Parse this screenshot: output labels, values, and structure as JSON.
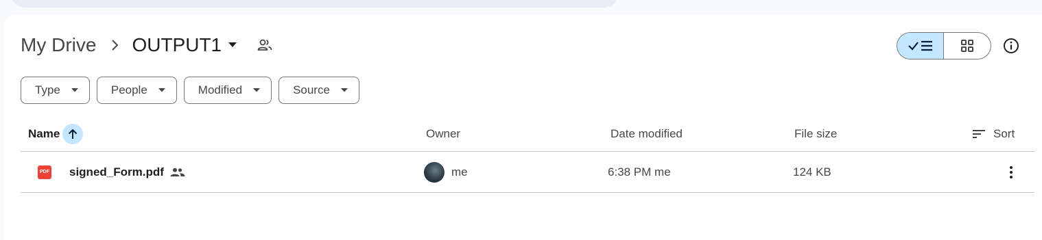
{
  "breadcrumb": {
    "root": "My Drive",
    "current": "OUTPUT1"
  },
  "filters": [
    {
      "label": "Type"
    },
    {
      "label": "People"
    },
    {
      "label": "Modified"
    },
    {
      "label": "Source"
    }
  ],
  "table": {
    "columns": {
      "name": "Name",
      "owner": "Owner",
      "date_modified": "Date modified",
      "file_size": "File size",
      "sort": "Sort"
    },
    "rows": [
      {
        "name": "signed_Form.pdf",
        "file_type_badge": "PDF",
        "owner": "me",
        "date_modified": "6:38 PM me",
        "file_size": "124 KB"
      }
    ]
  },
  "icons": {
    "file": "pdf-icon",
    "shared": "people-icon",
    "sort_direction": "arrow-up-icon",
    "sort": "sort-lines-icon",
    "more": "more-vertical-icon",
    "info": "info-icon",
    "list_view": "check-list-icon",
    "grid_view": "grid-icon"
  },
  "colors": {
    "accent": "#c2e7ff",
    "pdf_badge": "#ea4335",
    "border": "#747775",
    "divider": "#c4c7c5"
  }
}
